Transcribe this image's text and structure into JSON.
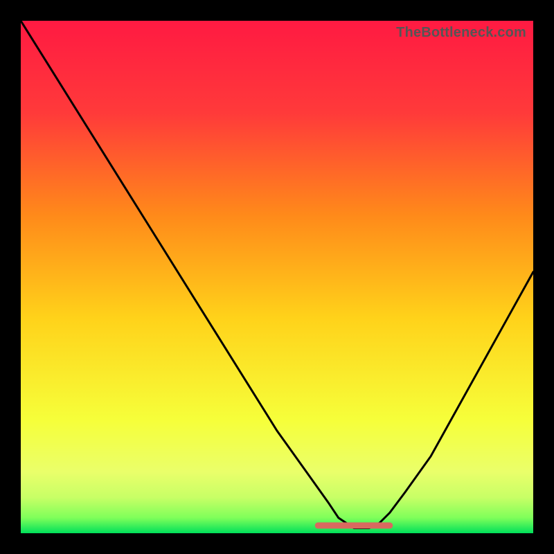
{
  "watermark": "TheBottleneck.com",
  "colors": {
    "gradient_top": "#ff1a42",
    "gradient_mid_upper": "#ff6a2a",
    "gradient_mid": "#ffd21a",
    "gradient_lower": "#f6ff3a",
    "gradient_green_light": "#9fff5a",
    "gradient_green": "#00e05a",
    "curve": "#000000",
    "flat_segment": "#d9695f",
    "frame": "#000000"
  },
  "chart_data": {
    "type": "line",
    "title": "",
    "xlabel": "",
    "ylabel": "",
    "xlim": [
      0,
      100
    ],
    "ylim": [
      0,
      100
    ],
    "x": [
      0,
      5,
      10,
      15,
      20,
      25,
      30,
      35,
      40,
      45,
      50,
      55,
      60,
      62,
      65,
      68,
      70,
      72,
      75,
      80,
      85,
      90,
      95,
      100
    ],
    "values": [
      100,
      92,
      84,
      76,
      68,
      60,
      52,
      44,
      36,
      28,
      20,
      13,
      6,
      3,
      1,
      1,
      2,
      4,
      8,
      15,
      24,
      33,
      42,
      51
    ],
    "flat_segment": {
      "x_start": 58,
      "x_end": 72,
      "y": 1.5
    },
    "notes": "V-shaped bottleneck curve over a vertical red→yellow→green heat gradient; minimum (optimal) sits roughly at x≈65 near y≈1. Axes have no visible tick labels."
  }
}
